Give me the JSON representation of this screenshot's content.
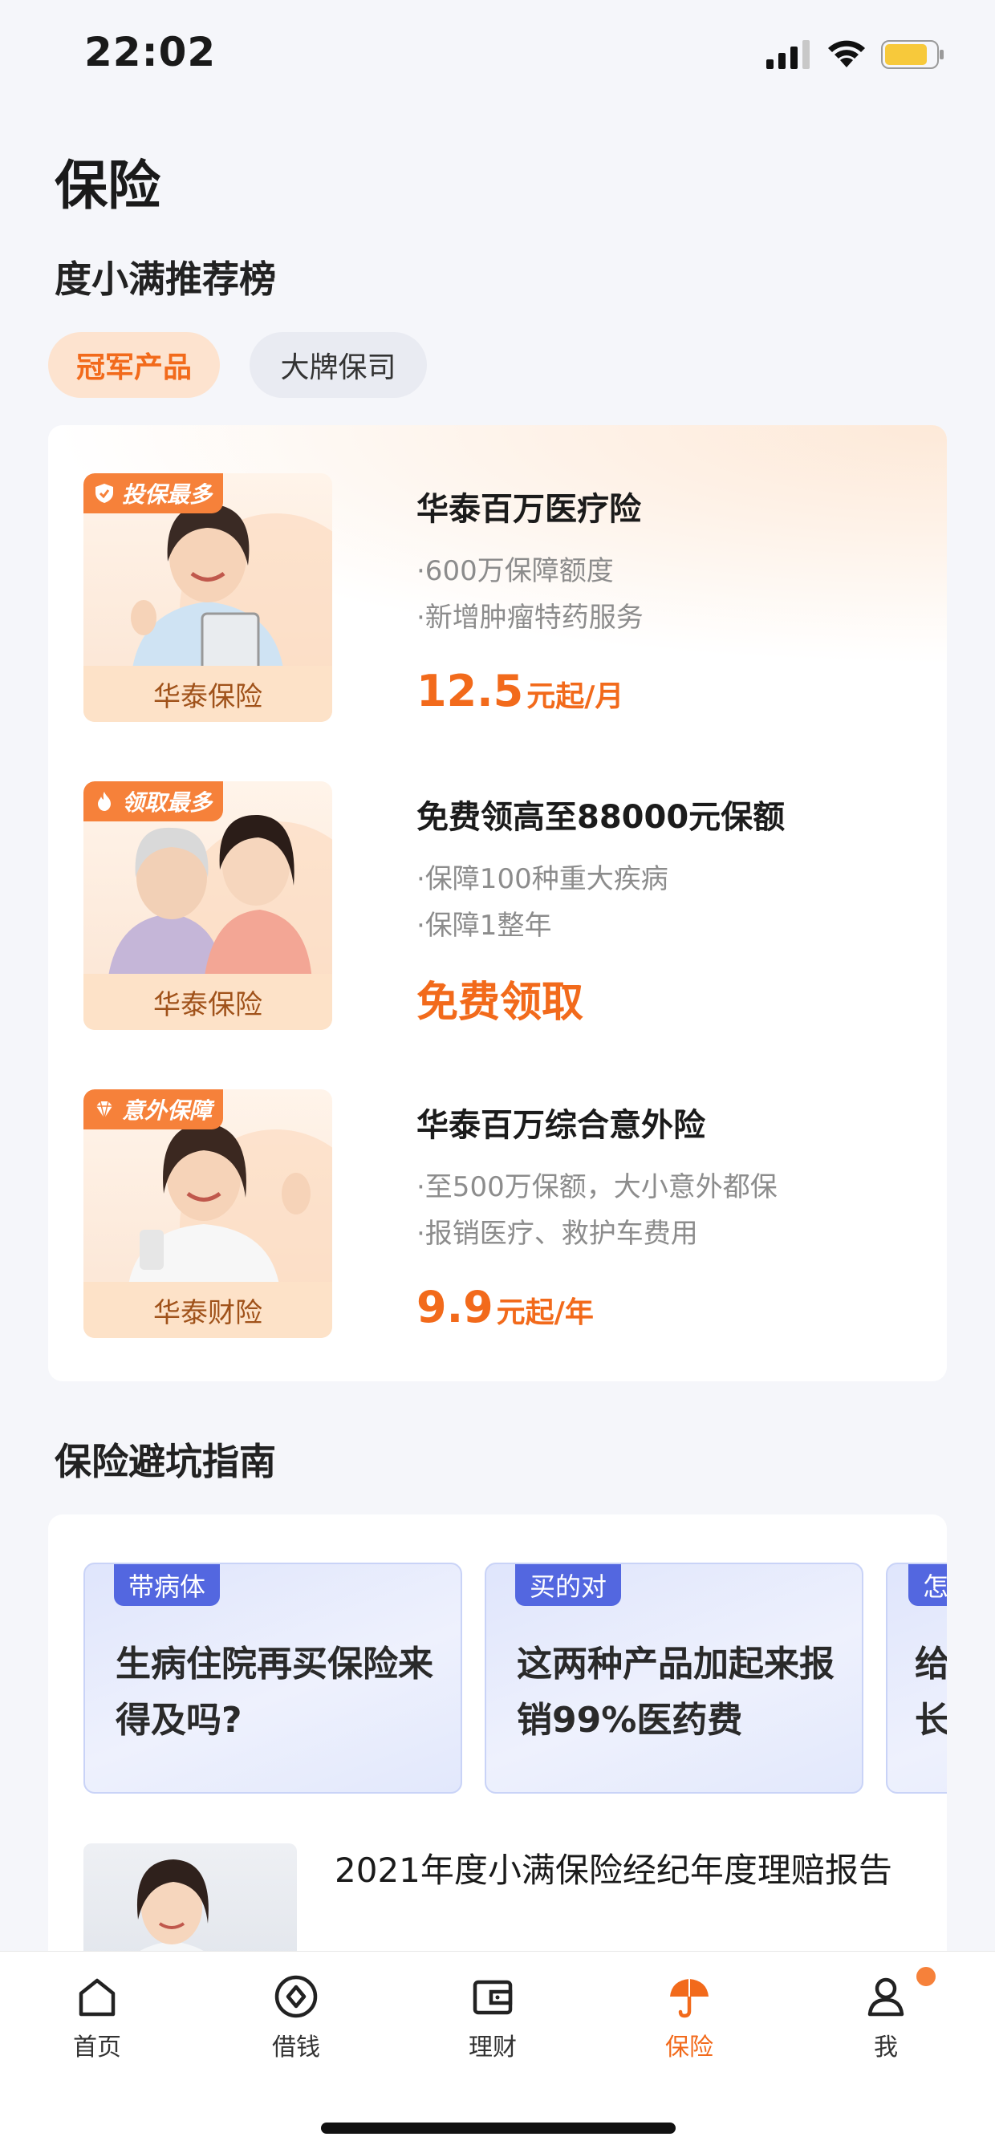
{
  "status_bar": {
    "time": "22:02"
  },
  "page": {
    "title": "保险"
  },
  "recommend": {
    "section_title": "度小满推荐榜",
    "chips": [
      {
        "label": "冠军产品",
        "active": true
      },
      {
        "label": "大牌保司",
        "active": false
      }
    ],
    "products": [
      {
        "badge": "投保最多",
        "badge_icon": "shield-check-icon",
        "company": "华泰保险",
        "name": "华泰百万医疗险",
        "features": [
          "·600万保障额度",
          "·新增肿瘤特药服务"
        ],
        "price_value": "12.5",
        "price_unit": "元起/月"
      },
      {
        "badge": "领取最多",
        "badge_icon": "flame-icon",
        "company": "华泰保险",
        "name": "免费领高至88000元保额",
        "features": [
          "·保障100种重大疾病",
          "·保障1整年"
        ],
        "action": "免费领取"
      },
      {
        "badge": "意外保障",
        "badge_icon": "diamond-icon",
        "company": "华泰财险",
        "name": "华泰百万综合意外险",
        "features": [
          "·至500万保额，大小意外都保",
          "·报销医疗、救护车费用"
        ],
        "price_value": "9.9",
        "price_unit": "元起/年"
      }
    ]
  },
  "guide": {
    "section_title": "保险避坑指南",
    "tiles": [
      {
        "tag": "带病体",
        "text": "生病住院再买保险来得及吗?"
      },
      {
        "tag": "买的对",
        "text": "这两种产品加起来报销99%医药费"
      },
      {
        "tag": "怎",
        "text": "给长"
      }
    ],
    "article": {
      "title": "2021年度小满保险经纪年度理赔报告"
    }
  },
  "tab_bar": {
    "items": [
      {
        "label": "首页",
        "icon": "home-icon",
        "active": false
      },
      {
        "label": "借钱",
        "icon": "loan-icon",
        "active": false
      },
      {
        "label": "理财",
        "icon": "wallet-icon",
        "active": false
      },
      {
        "label": "保险",
        "icon": "umbrella-icon",
        "active": true
      },
      {
        "label": "我",
        "icon": "person-icon",
        "active": false
      }
    ]
  },
  "colors": {
    "accent": "#f26a1b",
    "badge": "#f6813a",
    "tag_blue": "#5367e0",
    "background": "#f5f6fa"
  }
}
